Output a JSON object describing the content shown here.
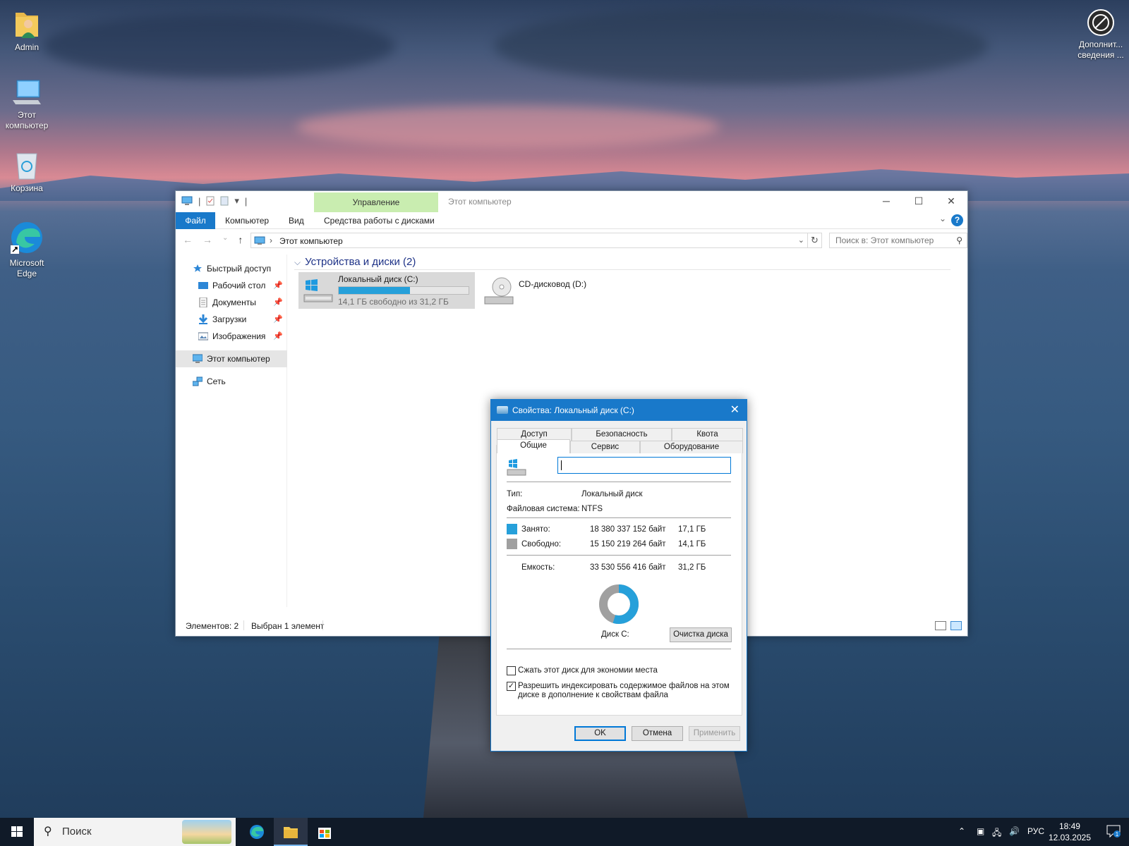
{
  "desktop": {
    "icons": [
      {
        "label": "Admin"
      },
      {
        "label": "Этот компьютер"
      },
      {
        "label": "Корзина"
      },
      {
        "label": "Microsoft Edge"
      },
      {
        "label": "Дополнит... сведения ..."
      }
    ]
  },
  "explorer": {
    "context_tab": "Управление",
    "title": "Этот компьютер",
    "ribbon_tabs": [
      "Файл",
      "Компьютер",
      "Вид",
      "Средства работы с дисками"
    ],
    "address_path": "Этот компьютер",
    "search_placeholder": "Поиск в: Этот компьютер",
    "nav": {
      "quick_access": "Быстрый доступ",
      "items": [
        {
          "label": "Рабочий стол",
          "pinned": true
        },
        {
          "label": "Документы",
          "pinned": true
        },
        {
          "label": "Загрузки",
          "pinned": true
        },
        {
          "label": "Изображения",
          "pinned": true
        }
      ],
      "this_pc": "Этот компьютер",
      "network": "Сеть"
    },
    "group_header": "Устройства и диски (2)",
    "drives": [
      {
        "name": "Локальный диск (C:)",
        "free_text": "14,1 ГБ свободно из 31,2 ГБ",
        "used_fraction": 0.548,
        "selected": true
      },
      {
        "name": "CD-дисковод (D:)"
      }
    ],
    "status": {
      "count": "Элементов: 2",
      "selected": "Выбран 1 элемент"
    }
  },
  "dialog": {
    "title": "Свойства: Локальный диск (C:)",
    "tabs_top": [
      "Доступ",
      "Безопасность",
      "Квота"
    ],
    "tabs_bottom": [
      "Общие",
      "Сервис",
      "Оборудование"
    ],
    "active_tab": "Общие",
    "volume_label_value": "",
    "type_label": "Тип:",
    "type_value": "Локальный диск",
    "fs_label": "Файловая система:",
    "fs_value": "NTFS",
    "used_label": "Занято:",
    "used_bytes": "18 380 337 152 байт",
    "used_gb": "17,1 ГБ",
    "free_label": "Свободно:",
    "free_bytes": "15 150 219 264 байт",
    "free_gb": "14,1 ГБ",
    "capacity_label": "Емкость:",
    "capacity_bytes": "33 530 556 416 байт",
    "capacity_gb": "31,2 ГБ",
    "used_fraction": 0.548,
    "used_color": "#26a0da",
    "free_color": "#a0a0a0",
    "disk_label": "Диск C:",
    "cleanup_button": "Очистка диска",
    "compress_label": "Сжать этот диск для экономии места",
    "compress_checked": false,
    "index_label_line1": "Разрешить индексировать содержимое файлов на этом",
    "index_label_line2": "диске в дополнение к свойствам файла",
    "index_checked": true,
    "ok": "OK",
    "cancel": "Отмена",
    "apply": "Применить"
  },
  "taskbar": {
    "search_placeholder": "Поиск",
    "language": "РУС",
    "time": "18:49",
    "date": "12.03.2025",
    "notification_count": "1"
  },
  "colors": {
    "accent": "#1979ca",
    "ribbon_context": "#c9edb0",
    "selection": "#cce8ff"
  }
}
